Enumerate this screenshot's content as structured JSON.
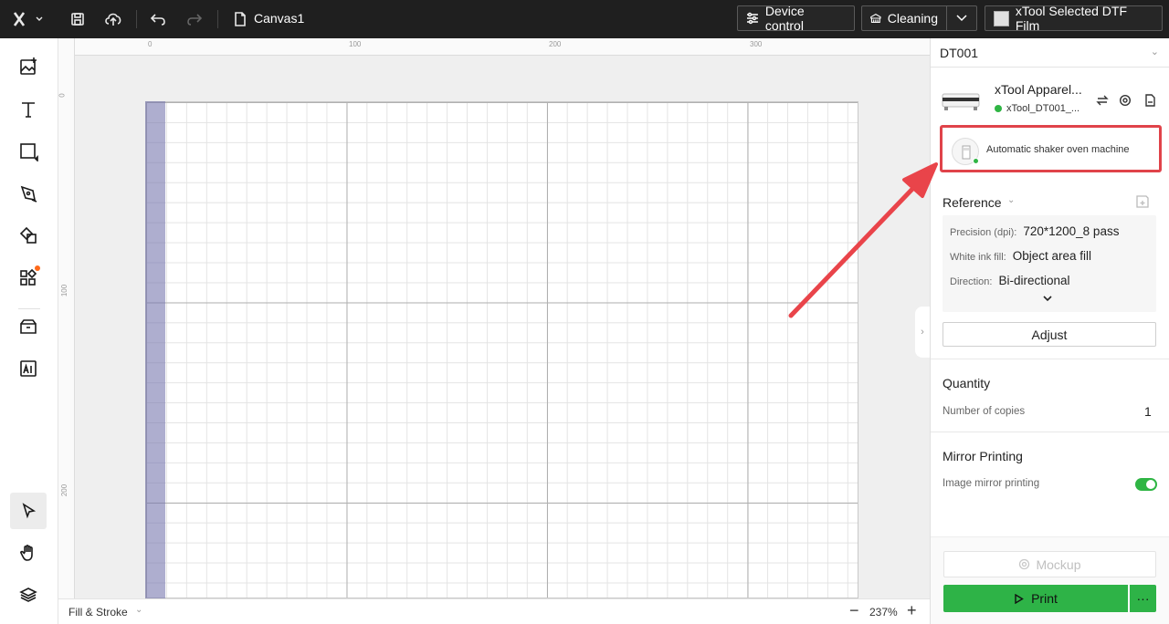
{
  "topbar": {
    "doc_title": "Canvas1",
    "device_control_label": "Device control",
    "cleaning_label": "Cleaning",
    "material_label": "xTool Selected DTF Film"
  },
  "left_tools": [
    {
      "name": "image-add-icon"
    },
    {
      "name": "text-icon"
    },
    {
      "name": "shape-icon"
    },
    {
      "name": "pen-icon"
    },
    {
      "name": "shapes-library-icon"
    },
    {
      "name": "apps-icon"
    },
    {
      "name": "material-box-icon"
    },
    {
      "name": "ai-image-icon"
    },
    {
      "name": "select-pointer-icon"
    },
    {
      "name": "hand-pan-icon"
    },
    {
      "name": "layers-icon"
    }
  ],
  "canvas": {
    "ruler_top_labels": [
      "0",
      "100",
      "200",
      "300"
    ],
    "ruler_left_labels": [
      "0",
      "100",
      "200"
    ],
    "zoom": "237%"
  },
  "bottombar": {
    "fill_stroke_label": "Fill & Stroke"
  },
  "right_panel": {
    "device_select": "DT001",
    "machine_name": "xTool Apparel...",
    "machine_id": "xTool_DT001_...",
    "shaker_label": "Automatic shaker oven machine",
    "reference": {
      "title": "Reference",
      "rows": [
        {
          "key": "Precision (dpi):",
          "value": "720*1200_8 pass"
        },
        {
          "key": "White ink fill:",
          "value": "Object area fill"
        },
        {
          "key": "Direction:",
          "value": "Bi-directional"
        }
      ]
    },
    "adjust_label": "Adjust",
    "quantity_title": "Quantity",
    "copies_label": "Number of copies",
    "copies_value": "1",
    "mirror_title": "Mirror Printing",
    "mirror_label": "Image mirror printing",
    "mirror_enabled": true,
    "mockup_label": "Mockup",
    "print_label": "Print"
  },
  "colors": {
    "accent_green": "#2eb347",
    "highlight_red": "#e0434a",
    "topbar_bg": "#1f1f1f"
  }
}
